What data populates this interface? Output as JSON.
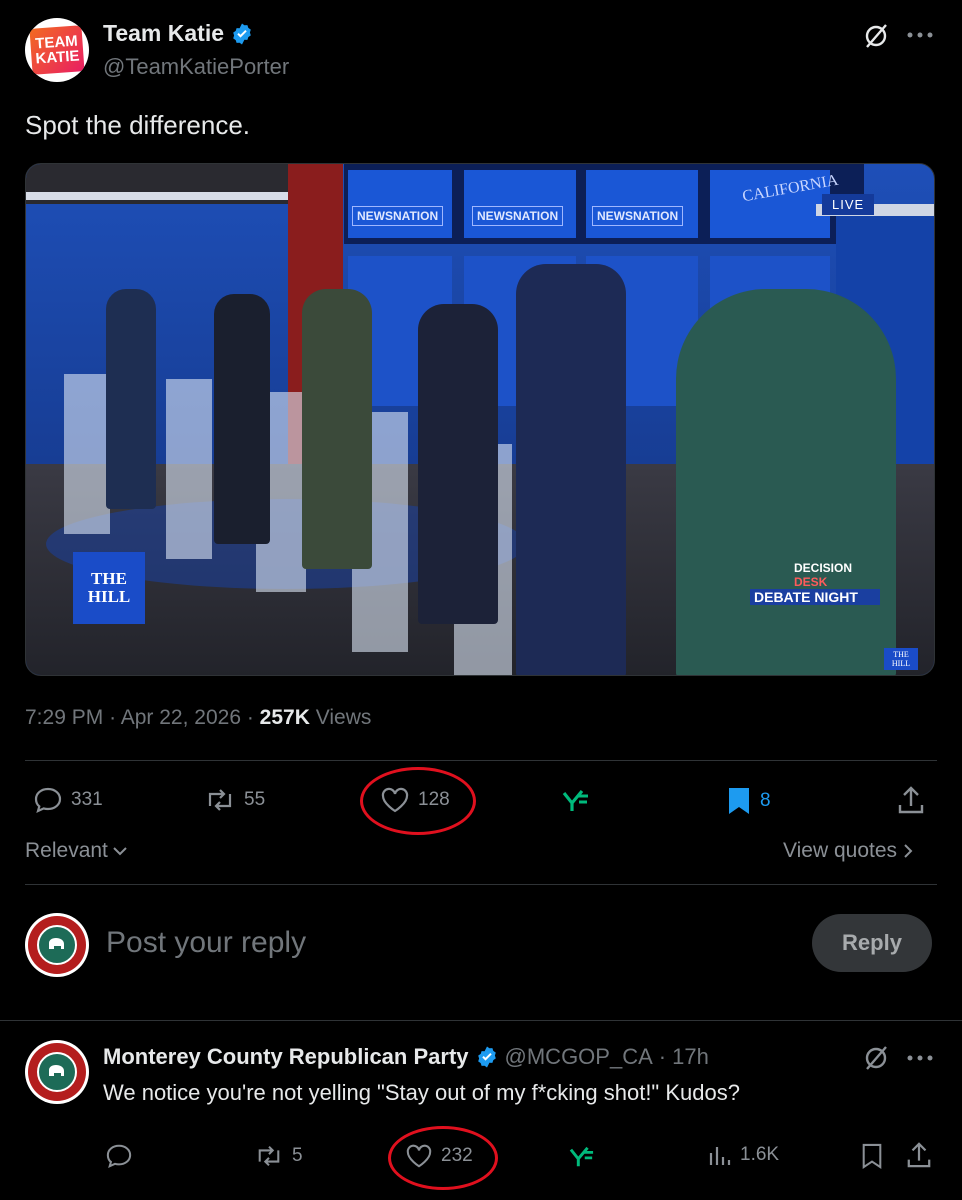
{
  "post": {
    "author_name": "Team Katie",
    "author_handle": "@TeamKatiePorter",
    "avatar_text_top": "TEAM",
    "avatar_text_bottom": "KATIE",
    "text": "Spot the difference.",
    "time": "7:29 PM",
    "date": "Apr 22, 2026",
    "views_count": "257K",
    "views_label": "Views",
    "replies": "331",
    "reposts": "55",
    "likes": "128",
    "bookmarks": "8"
  },
  "image": {
    "banner_text": "NEWSNATION",
    "california_text": "CALIFORNIA",
    "live_label": "LIVE",
    "hill_logo": "THE HILL",
    "bug_line1": "DECISION",
    "bug_line2": "DESK",
    "bug_line3": "DEBATE NIGHT"
  },
  "filters": {
    "sort_label": "Relevant",
    "quotes_label": "View quotes"
  },
  "composer": {
    "placeholder": "Post your reply",
    "reply_button": "Reply"
  },
  "reply": {
    "author_name": "Monterey County Republican Party",
    "author_handle": "@MCGOP_CA",
    "time_ago": "17h",
    "text": "We notice you're not yelling \"Stay out of my f*cking shot!\" Kudos?",
    "reposts": "5",
    "likes": "232",
    "views": "1.6K"
  },
  "colors": {
    "background": "#000000",
    "verified": "#1d9bf0",
    "bookmark_active": "#1d9bf0",
    "grok_green": "#00ba7c",
    "highlight_ring": "#e0101e"
  }
}
